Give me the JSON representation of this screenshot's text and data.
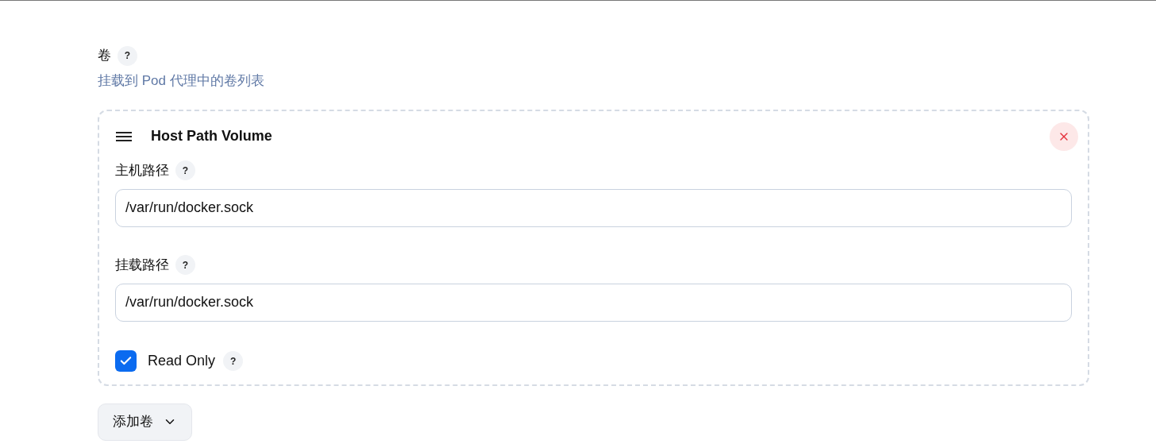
{
  "section": {
    "label": "卷",
    "help": "?",
    "description": "挂载到 Pod 代理中的卷列表"
  },
  "volumes": [
    {
      "title": "Host Path Volume",
      "fields": [
        {
          "kind": "text",
          "label": "主机路径",
          "help": "?",
          "value": "/var/run/docker.sock"
        },
        {
          "kind": "text",
          "label": "挂载路径",
          "help": "?",
          "value": "/var/run/docker.sock"
        },
        {
          "kind": "checkbox",
          "label": "Read Only",
          "help": "?",
          "checked": true
        }
      ]
    }
  ],
  "add_button": {
    "label": "添加卷"
  }
}
